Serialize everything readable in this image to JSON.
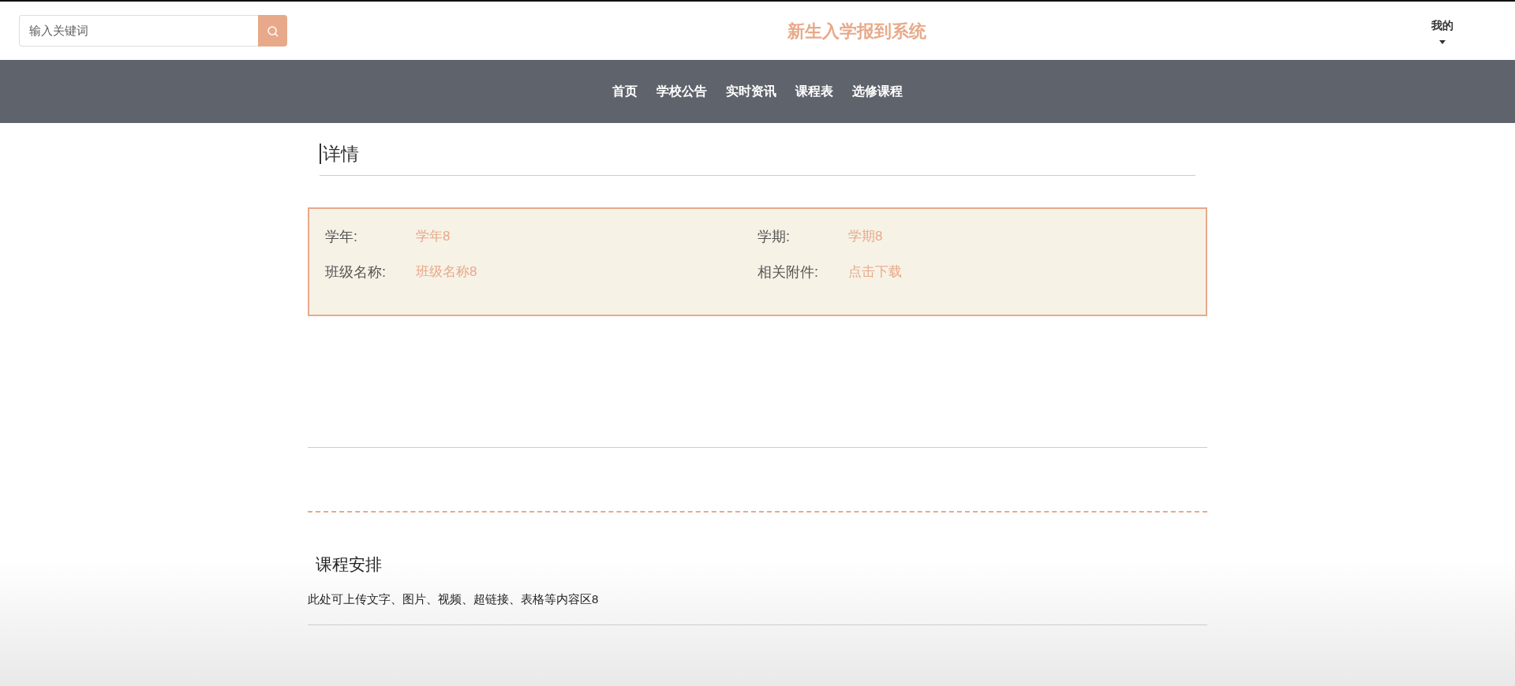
{
  "header": {
    "search": {
      "placeholder": "输入关键词"
    },
    "site_title": "新生入学报到系统",
    "user_menu": "我的"
  },
  "nav": [
    {
      "label": "首页"
    },
    {
      "label": "学校公告"
    },
    {
      "label": "实时资讯"
    },
    {
      "label": "课程表"
    },
    {
      "label": "选修课程"
    }
  ],
  "detail": {
    "title": "详情",
    "fields": [
      {
        "label": "学年:",
        "value": "学年8"
      },
      {
        "label": "学期:",
        "value": "学期8"
      },
      {
        "label": "班级名称:",
        "value": "班级名称8"
      },
      {
        "label": "相关附件:",
        "value": "点击下载"
      }
    ]
  },
  "section": {
    "title": "课程安排",
    "content": "此处可上传文字、图片、视频、超链接、表格等内容区8"
  }
}
